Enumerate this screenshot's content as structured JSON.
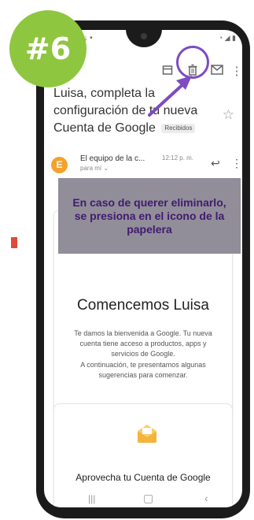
{
  "step_badge": "#6",
  "email": {
    "subject": "Luisa, completa la configuración de tu nueva Cuenta de Google",
    "label": "Recibidos",
    "sender": "El equipo de la c...",
    "time": "12:12 p. m.",
    "recipient": "para mí",
    "greeting": "Comencemos Luisa",
    "body_1": "Te damos la bienvenida a Google. Tu nueva cuenta tiene acceso a productos, apps y servicios de Google.",
    "body_2": "A continuación, te presentamos algunas sugerencias para comenzar.",
    "card2_title": "Aprovecha tu Cuenta de Google",
    "avatar_letter": "E"
  },
  "annotation": {
    "text": "En caso de querer eliminarlo, se presiona en el icono de la papelera"
  },
  "icons": [
    "archive-icon",
    "trash-icon",
    "mail-icon",
    "more-vert-icon",
    "star-icon",
    "reply-icon",
    "envelope-icon"
  ],
  "colors": {
    "badge_green": "#8fc63f",
    "annotation_purple": "#7d4bc2",
    "avatar_orange": "#f4a12e"
  }
}
